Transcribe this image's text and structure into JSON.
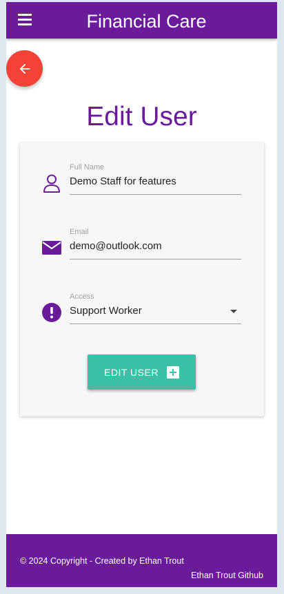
{
  "app": {
    "title": "Financial Care"
  },
  "page": {
    "title": "Edit User"
  },
  "form": {
    "fullname": {
      "label": "Full Name",
      "value": "Demo Staff for features"
    },
    "email": {
      "label": "Email",
      "value": "demo@outlook.com"
    },
    "access": {
      "label": "Access",
      "selected": "Support Worker"
    },
    "submit_label": "EDIT USER"
  },
  "footer": {
    "copyright": "© 2024 Copyright - Created by Ethan Trout",
    "github_link": "Ethan Trout Github"
  },
  "colors": {
    "primary": "#6a1b9a",
    "back_button": "#f44336",
    "submit_button": "#3bbfa5"
  },
  "icons": {
    "menu": "hamburger-icon",
    "back": "arrow-left-icon",
    "fullname": "person-icon",
    "email": "envelope-icon",
    "access": "exclamation-circle-icon",
    "submit": "plus-square-icon"
  }
}
